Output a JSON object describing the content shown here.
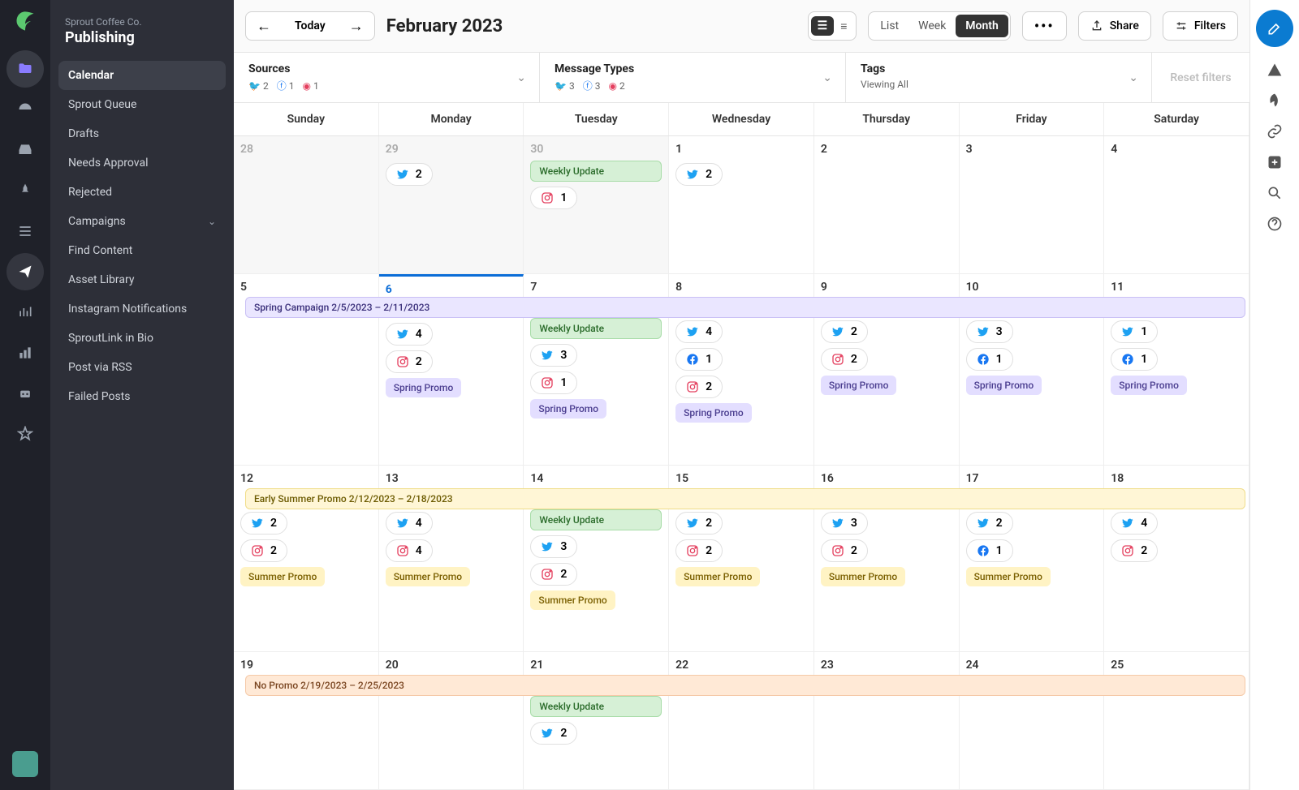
{
  "org": "Sprout Coffee Co.",
  "section": "Publishing",
  "nav": [
    "Calendar",
    "Sprout Queue",
    "Drafts",
    "Needs Approval",
    "Rejected",
    "Campaigns",
    "Find Content",
    "Asset Library",
    "Instagram Notifications",
    "SproutLink in Bio",
    "Post via RSS",
    "Failed Posts"
  ],
  "toolbar": {
    "today": "Today",
    "month": "February 2023",
    "views": [
      "List",
      "Week",
      "Month"
    ],
    "share": "Share",
    "filters": "Filters"
  },
  "filters": {
    "sources": {
      "title": "Sources",
      "tw": "2",
      "fb": "1",
      "ig": "1"
    },
    "types": {
      "title": "Message Types",
      "tw": "3",
      "fb": "3",
      "ig": "2"
    },
    "tags": {
      "title": "Tags",
      "sub": "Viewing All"
    },
    "reset": "Reset filters"
  },
  "dow": [
    "Sunday",
    "Monday",
    "Tuesday",
    "Wednesday",
    "Thursday",
    "Friday",
    "Saturday"
  ],
  "weekly": "Weekly Update",
  "spring_promo": "Spring Promo",
  "summer_promo": "Summer Promo",
  "campaigns": {
    "spring": "Spring Campaign 2/5/2023 – 2/11/2023",
    "summer": "Early Summer Promo 2/12/2023 – 2/18/2023",
    "nopromo": "No Promo 2/19/2023 – 2/25/2023"
  },
  "days": {
    "w1": [
      {
        "n": "28",
        "other": true
      },
      {
        "n": "29",
        "other": true,
        "chips": [
          {
            "t": "tw",
            "c": "2"
          }
        ]
      },
      {
        "n": "30",
        "other": true,
        "weekly": true,
        "chips": [
          {
            "t": "ig",
            "c": "1"
          }
        ]
      },
      {
        "n": "1",
        "chips": [
          {
            "t": "tw",
            "c": "2"
          }
        ]
      },
      {
        "n": "2"
      },
      {
        "n": "3"
      },
      {
        "n": "4"
      }
    ],
    "w2": [
      {
        "n": "5"
      },
      {
        "n": "6",
        "today": true,
        "chips": [
          {
            "t": "tw",
            "c": "4"
          },
          {
            "t": "ig",
            "c": "2"
          }
        ],
        "tag": "spring"
      },
      {
        "n": "7",
        "weekly": true,
        "chips": [
          {
            "t": "tw",
            "c": "3"
          },
          {
            "t": "ig",
            "c": "1"
          }
        ],
        "tag": "spring"
      },
      {
        "n": "8",
        "chips": [
          {
            "t": "tw",
            "c": "4"
          },
          {
            "t": "fb",
            "c": "1"
          },
          {
            "t": "ig",
            "c": "2"
          }
        ],
        "tag": "spring"
      },
      {
        "n": "9",
        "chips": [
          {
            "t": "tw",
            "c": "2"
          },
          {
            "t": "ig",
            "c": "2"
          }
        ],
        "tag": "spring"
      },
      {
        "n": "10",
        "chips": [
          {
            "t": "tw",
            "c": "3"
          },
          {
            "t": "fb",
            "c": "1"
          }
        ],
        "tag": "spring"
      },
      {
        "n": "11",
        "chips": [
          {
            "t": "tw",
            "c": "1"
          },
          {
            "t": "fb",
            "c": "1"
          }
        ],
        "tag": "spring"
      }
    ],
    "w3": [
      {
        "n": "12",
        "chips": [
          {
            "t": "tw",
            "c": "2"
          },
          {
            "t": "ig",
            "c": "2"
          }
        ],
        "tag": "summer"
      },
      {
        "n": "13",
        "chips": [
          {
            "t": "tw",
            "c": "4"
          },
          {
            "t": "ig",
            "c": "4"
          }
        ],
        "tag": "summer"
      },
      {
        "n": "14",
        "weekly": true,
        "chips": [
          {
            "t": "tw",
            "c": "3"
          },
          {
            "t": "ig",
            "c": "2"
          }
        ],
        "tag": "summer"
      },
      {
        "n": "15",
        "chips": [
          {
            "t": "tw",
            "c": "2"
          },
          {
            "t": "ig",
            "c": "2"
          }
        ],
        "tag": "summer"
      },
      {
        "n": "16",
        "chips": [
          {
            "t": "tw",
            "c": "3"
          },
          {
            "t": "ig",
            "c": "2"
          }
        ],
        "tag": "summer"
      },
      {
        "n": "17",
        "chips": [
          {
            "t": "tw",
            "c": "2"
          },
          {
            "t": "fb",
            "c": "1"
          }
        ],
        "tag": "summer"
      },
      {
        "n": "18",
        "chips": [
          {
            "t": "tw",
            "c": "4"
          },
          {
            "t": "ig",
            "c": "2"
          }
        ]
      }
    ],
    "w4": [
      {
        "n": "19"
      },
      {
        "n": "20"
      },
      {
        "n": "21",
        "weekly": true,
        "chips": [
          {
            "t": "tw",
            "c": "2"
          }
        ],
        "partial": true
      },
      {
        "n": "22"
      },
      {
        "n": "23"
      },
      {
        "n": "24"
      },
      {
        "n": "25"
      }
    ]
  }
}
